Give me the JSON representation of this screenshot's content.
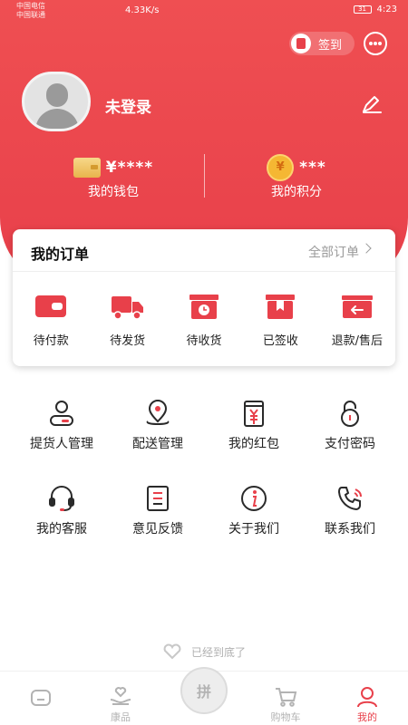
{
  "status_bar": {
    "carrier_1": "中国电信",
    "carrier_2": "中国联通",
    "net_speed": "4.33K/s",
    "time": "4:23",
    "battery": "31"
  },
  "header": {
    "signin_label": "签到"
  },
  "profile": {
    "username": "未登录"
  },
  "stats": {
    "wallet_value": "¥****",
    "wallet_label": "我的钱包",
    "points_value": "***",
    "points_label": "我的积分",
    "coin_symbol": "¥"
  },
  "orders": {
    "title": "我的订单",
    "all_label": "全部订单",
    "items": [
      {
        "label": "待付款",
        "icon": "wallet-icon"
      },
      {
        "label": "待发货",
        "icon": "truck-icon"
      },
      {
        "label": "待收货",
        "icon": "clock-box-icon"
      },
      {
        "label": "已签收",
        "icon": "bookmark-box-icon"
      },
      {
        "label": "退款/售后",
        "icon": "return-icon"
      }
    ]
  },
  "services": [
    {
      "label": "提货人管理",
      "icon": "user-card-icon"
    },
    {
      "label": "配送管理",
      "icon": "location-pin-icon"
    },
    {
      "label": "我的红包",
      "icon": "red-envelope-icon"
    },
    {
      "label": "支付密码",
      "icon": "lock-icon"
    },
    {
      "label": "我的客服",
      "icon": "headset-icon"
    },
    {
      "label": "意见反馈",
      "icon": "feedback-icon"
    },
    {
      "label": "关于我们",
      "icon": "info-icon"
    },
    {
      "label": "联系我们",
      "icon": "phone-icon"
    }
  ],
  "footer_note": "已经到底了",
  "tabbar": {
    "tabs": [
      {
        "label": "",
        "icon": "home-icon"
      },
      {
        "label": "康品",
        "icon": "hands-heart-icon"
      },
      {
        "label": "拼",
        "icon": "pin-group-icon"
      },
      {
        "label": "购物车",
        "icon": "cart-icon"
      },
      {
        "label": "我的",
        "icon": "user-icon",
        "active": true
      }
    ]
  },
  "colors": {
    "accent": "#e8404a",
    "hero_top": "#ef4f52",
    "inactive_tab": "#b3b3b3"
  }
}
